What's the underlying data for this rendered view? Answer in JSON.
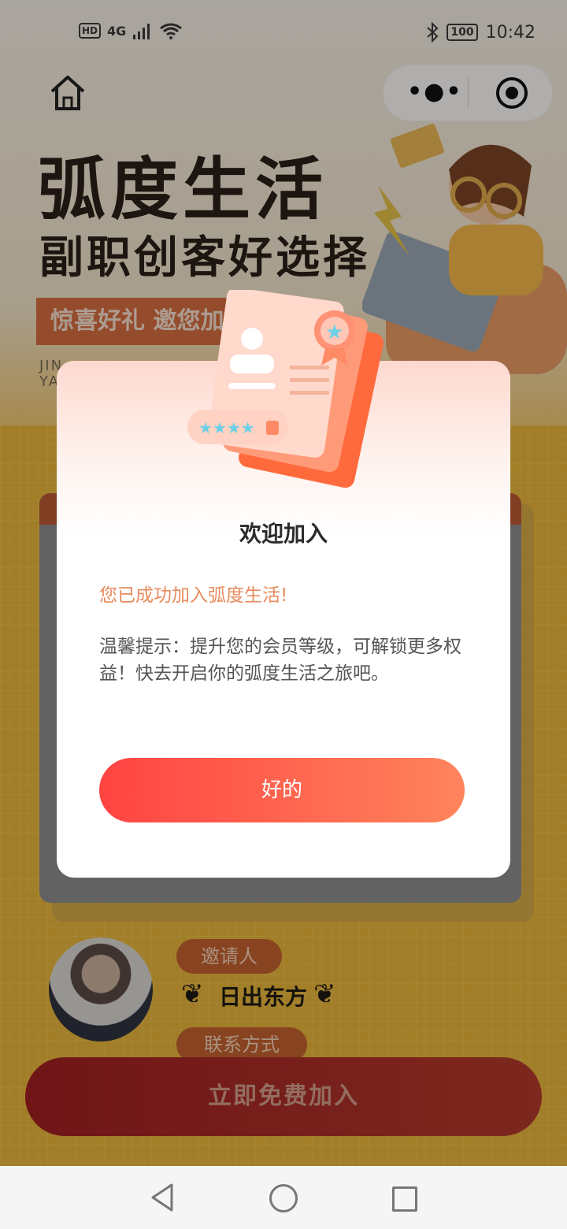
{
  "status_bar": {
    "hd": "HD",
    "network": "4G",
    "battery": "100",
    "time": "10:42"
  },
  "hero": {
    "title": "弧度生活",
    "subtitle": "副职创客好选择",
    "tag": "惊喜好礼 邀您加入",
    "small_text_line1": "JIN",
    "small_text_line2": "YA"
  },
  "modal": {
    "title": "欢迎加入",
    "message": "您已成功加入弧度生活!",
    "tip": "温馨提示：提升您的会员等级，可解锁更多权益！快去开启你的弧度生活之旅吧。",
    "ok_button": "好的"
  },
  "inviter": {
    "label": "邀请人",
    "name": "日出东方",
    "contact_label": "联系方式"
  },
  "join_button": "立即免费加入",
  "colors": {
    "accent": "#ff4442",
    "accent_end": "#ff845c",
    "message": "#e78b5c",
    "background": "#e9b93b"
  },
  "icons": [
    "home-icon",
    "more-dots-icon",
    "target-icon",
    "bluetooth-icon",
    "wifi-icon",
    "signal-icon",
    "back-triangle-icon",
    "home-circle-icon",
    "recent-square-icon"
  ]
}
